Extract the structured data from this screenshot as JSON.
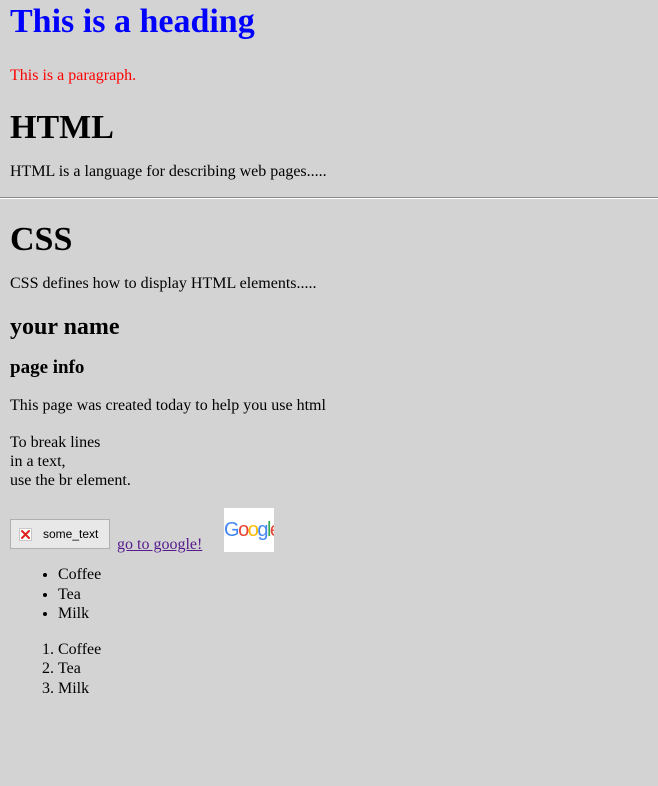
{
  "headings": {
    "main": "This is a heading",
    "html": "HTML",
    "css": "CSS",
    "name": "your name",
    "info": "page info"
  },
  "paragraphs": {
    "red": "This is a paragraph.",
    "html_desc": "HTML is a language for describing web pages.....",
    "css_desc": "CSS defines how to display HTML elements.....",
    "created": "This page was created today to help you use html",
    "break_lines": [
      "To break lines",
      "in a text,",
      "use the br element."
    ]
  },
  "image_alt": "some_text",
  "link": {
    "label": "go to google!"
  },
  "logo_text": "Google",
  "unordered_list": [
    "Coffee",
    "Tea",
    "Milk"
  ],
  "ordered_list": [
    "Coffee",
    "Tea",
    "Milk"
  ],
  "colors": {
    "background": "#d3d3d3",
    "heading": "#0000ff",
    "paragraph": "#ff0000",
    "visited_link": "#551a8b"
  },
  "icons": {
    "broken_image": "broken-image-icon"
  }
}
